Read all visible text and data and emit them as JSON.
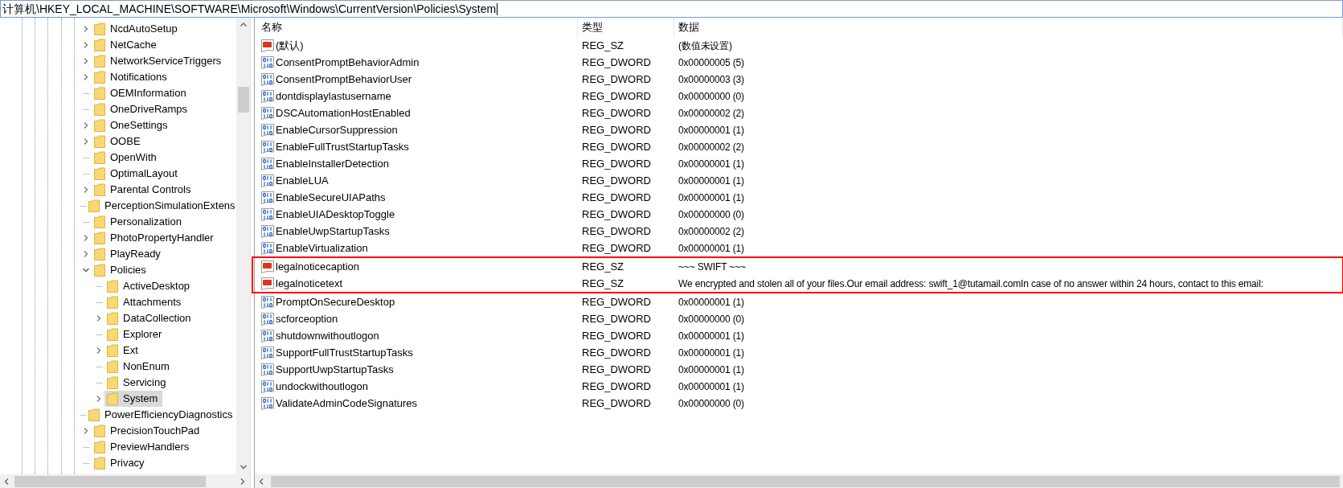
{
  "address_bar": {
    "value": "计算机\\HKEY_LOCAL_MACHINE\\SOFTWARE\\Microsoft\\Windows\\CurrentVersion\\Policies\\System"
  },
  "tree": [
    {
      "label": "NcdAutoSetup",
      "expandable": true,
      "expanded": false,
      "selected": false
    },
    {
      "label": "NetCache",
      "expandable": true,
      "expanded": false,
      "selected": false
    },
    {
      "label": "NetworkServiceTriggers",
      "expandable": true,
      "expanded": false,
      "selected": false
    },
    {
      "label": "Notifications",
      "expandable": true,
      "expanded": false,
      "selected": false
    },
    {
      "label": "OEMInformation",
      "expandable": false,
      "selected": false
    },
    {
      "label": "OneDriveRamps",
      "expandable": false,
      "selected": false
    },
    {
      "label": "OneSettings",
      "expandable": true,
      "expanded": false,
      "selected": false
    },
    {
      "label": "OOBE",
      "expandable": true,
      "expanded": false,
      "selected": false
    },
    {
      "label": "OpenWith",
      "expandable": false,
      "selected": false
    },
    {
      "label": "OptimalLayout",
      "expandable": false,
      "selected": false
    },
    {
      "label": "Parental Controls",
      "expandable": true,
      "expanded": false,
      "selected": false
    },
    {
      "label": "PerceptionSimulationExtens",
      "expandable": false,
      "selected": false
    },
    {
      "label": "Personalization",
      "expandable": false,
      "selected": false
    },
    {
      "label": "PhotoPropertyHandler",
      "expandable": true,
      "expanded": false,
      "selected": false
    },
    {
      "label": "PlayReady",
      "expandable": true,
      "expanded": false,
      "selected": false
    },
    {
      "label": "Policies",
      "expandable": true,
      "expanded": true,
      "selected": false,
      "children": [
        {
          "label": "ActiveDesktop",
          "expandable": false,
          "selected": false
        },
        {
          "label": "Attachments",
          "expandable": false,
          "selected": false
        },
        {
          "label": "DataCollection",
          "expandable": true,
          "expanded": false,
          "selected": false
        },
        {
          "label": "Explorer",
          "expandable": false,
          "selected": false
        },
        {
          "label": "Ext",
          "expandable": true,
          "expanded": false,
          "selected": false
        },
        {
          "label": "NonEnum",
          "expandable": false,
          "selected": false
        },
        {
          "label": "Servicing",
          "expandable": false,
          "selected": false
        },
        {
          "label": "System",
          "expandable": true,
          "expanded": false,
          "selected": true
        }
      ]
    },
    {
      "label": "PowerEfficiencyDiagnostics",
      "expandable": false,
      "selected": false
    },
    {
      "label": "PrecisionTouchPad",
      "expandable": true,
      "expanded": false,
      "selected": false
    },
    {
      "label": "PreviewHandlers",
      "expandable": false,
      "selected": false
    },
    {
      "label": "Privacy",
      "expandable": false,
      "selected": false
    }
  ],
  "values": {
    "columns": [
      "名称",
      "类型",
      "数据"
    ],
    "rows": [
      {
        "kind": "string",
        "name": "(默认)",
        "type": "REG_SZ",
        "data": "(数值未设置)",
        "highlighted": false
      },
      {
        "kind": "dword",
        "name": "ConsentPromptBehaviorAdmin",
        "type": "REG_DWORD",
        "data": "0x00000005 (5)",
        "highlighted": false
      },
      {
        "kind": "dword",
        "name": "ConsentPromptBehaviorUser",
        "type": "REG_DWORD",
        "data": "0x00000003 (3)",
        "highlighted": false
      },
      {
        "kind": "dword",
        "name": "dontdisplaylastusername",
        "type": "REG_DWORD",
        "data": "0x00000000 (0)",
        "highlighted": false
      },
      {
        "kind": "dword",
        "name": "DSCAutomationHostEnabled",
        "type": "REG_DWORD",
        "data": "0x00000002 (2)",
        "highlighted": false
      },
      {
        "kind": "dword",
        "name": "EnableCursorSuppression",
        "type": "REG_DWORD",
        "data": "0x00000001 (1)",
        "highlighted": false
      },
      {
        "kind": "dword",
        "name": "EnableFullTrustStartupTasks",
        "type": "REG_DWORD",
        "data": "0x00000002 (2)",
        "highlighted": false
      },
      {
        "kind": "dword",
        "name": "EnableInstallerDetection",
        "type": "REG_DWORD",
        "data": "0x00000001 (1)",
        "highlighted": false
      },
      {
        "kind": "dword",
        "name": "EnableLUA",
        "type": "REG_DWORD",
        "data": "0x00000001 (1)",
        "highlighted": false
      },
      {
        "kind": "dword",
        "name": "EnableSecureUIAPaths",
        "type": "REG_DWORD",
        "data": "0x00000001 (1)",
        "highlighted": false
      },
      {
        "kind": "dword",
        "name": "EnableUIADesktopToggle",
        "type": "REG_DWORD",
        "data": "0x00000000 (0)",
        "highlighted": false
      },
      {
        "kind": "dword",
        "name": "EnableUwpStartupTasks",
        "type": "REG_DWORD",
        "data": "0x00000002 (2)",
        "highlighted": false
      },
      {
        "kind": "dword",
        "name": "EnableVirtualization",
        "type": "REG_DWORD",
        "data": "0x00000001 (1)",
        "highlighted": false
      },
      {
        "kind": "string",
        "name": "legalnoticecaption",
        "type": "REG_SZ",
        "data": "~~~ SWIFT ~~~",
        "highlighted": true
      },
      {
        "kind": "string",
        "name": "legalnoticetext",
        "type": "REG_SZ",
        "data": "We encrypted and stolen all of your files.Our email address: swift_1@tutamail.comIn case of no answer within 24 hours, contact to this email:",
        "highlighted": true
      },
      {
        "kind": "dword",
        "name": "PromptOnSecureDesktop",
        "type": "REG_DWORD",
        "data": "0x00000001 (1)",
        "highlighted": false
      },
      {
        "kind": "dword",
        "name": "scforceoption",
        "type": "REG_DWORD",
        "data": "0x00000000 (0)",
        "highlighted": false
      },
      {
        "kind": "dword",
        "name": "shutdownwithoutlogon",
        "type": "REG_DWORD",
        "data": "0x00000001 (1)",
        "highlighted": false
      },
      {
        "kind": "dword",
        "name": "SupportFullTrustStartupTasks",
        "type": "REG_DWORD",
        "data": "0x00000001 (1)",
        "highlighted": false
      },
      {
        "kind": "dword",
        "name": "SupportUwpStartupTasks",
        "type": "REG_DWORD",
        "data": "0x00000001 (1)",
        "highlighted": false
      },
      {
        "kind": "dword",
        "name": "undockwithoutlogon",
        "type": "REG_DWORD",
        "data": "0x00000001 (1)",
        "highlighted": false
      },
      {
        "kind": "dword",
        "name": "ValidateAdminCodeSignatures",
        "type": "REG_DWORD",
        "data": "0x00000000 (0)",
        "highlighted": false
      }
    ]
  }
}
